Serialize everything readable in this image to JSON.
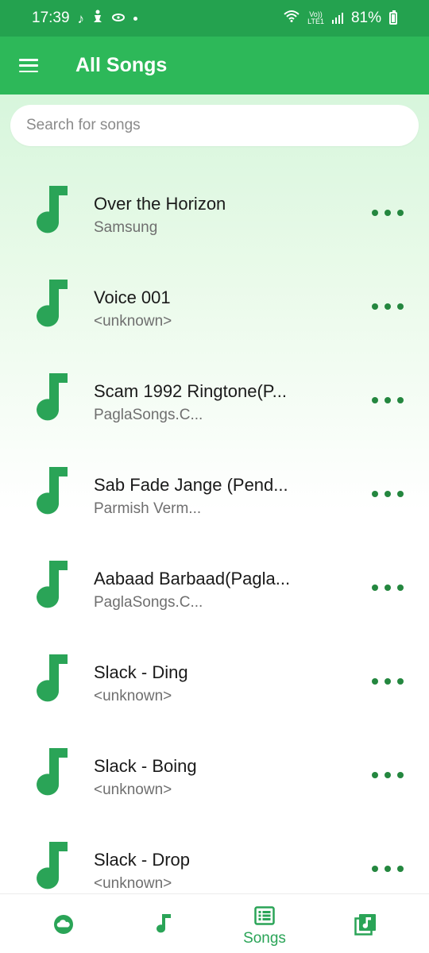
{
  "status_bar": {
    "time": "17:39",
    "lte_label": "Vo))",
    "lte_sub": "LTE1",
    "battery_text": "81%"
  },
  "app_bar": {
    "menu_icon": "hamburger-menu-icon",
    "title": "All Songs"
  },
  "search": {
    "placeholder": "Search for songs"
  },
  "songs": [
    {
      "title": "Over the Horizon",
      "artist": "Samsung"
    },
    {
      "title": "Voice 001",
      "artist": "<unknown>"
    },
    {
      "title": "Scam 1992 Ringtone(P...",
      "artist": "PaglaSongs.C..."
    },
    {
      "title": "Sab Fade Jange (Pend...",
      "artist": "Parmish Verm..."
    },
    {
      "title": "Aabaad Barbaad(Pagla...",
      "artist": "PaglaSongs.C..."
    },
    {
      "title": "Slack - Ding",
      "artist": "<unknown>"
    },
    {
      "title": "Slack - Boing",
      "artist": "<unknown>"
    },
    {
      "title": "Slack - Drop",
      "artist": "<unknown>"
    }
  ],
  "bottom_nav": {
    "items": [
      {
        "icon": "cloud-icon",
        "label": ""
      },
      {
        "icon": "music-note-icon",
        "label": ""
      },
      {
        "icon": "list-icon",
        "label": "Songs",
        "active": true
      },
      {
        "icon": "playlist-icon",
        "label": ""
      }
    ]
  },
  "colors": {
    "status_bar": "#24a24f",
    "app_bar": "#2db859",
    "accent": "#2db859",
    "more_dots": "#24873f"
  }
}
